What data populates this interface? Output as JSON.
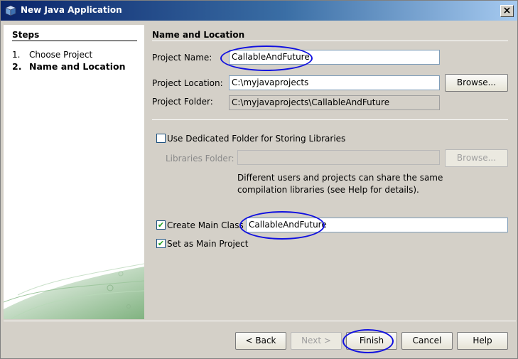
{
  "window": {
    "title": "New Java Application",
    "close": "×"
  },
  "steps": {
    "title": "Steps",
    "items": [
      {
        "num": "1.",
        "label": "Choose Project"
      },
      {
        "num": "2.",
        "label": "Name and Location"
      }
    ]
  },
  "form": {
    "section_title": "Name and Location",
    "project_name": {
      "label": "Project Name:",
      "value": "CallableAndFuture"
    },
    "project_location": {
      "label": "Project Location:",
      "value": "C:\\myjavaprojects",
      "browse": "Browse..."
    },
    "project_folder": {
      "label": "Project Folder:",
      "value": "C:\\myjavaprojects\\CallableAndFuture"
    },
    "dedicated_folder": {
      "label": "Use Dedicated Folder for Storing Libraries",
      "checked": false
    },
    "libraries_folder": {
      "label": "Libraries Folder:",
      "value": "",
      "browse": "Browse..."
    },
    "hint_line1": "Different users and projects can share the same",
    "hint_line2": "compilation libraries (see Help for details).",
    "create_main_class": {
      "label": "Create Main Class",
      "value": "CallableAndFuture",
      "checked": true
    },
    "set_main_project": {
      "label": "Set as Main Project",
      "checked": true
    }
  },
  "buttons": {
    "back": "< Back",
    "next": "Next >",
    "finish": "Finish",
    "cancel": "Cancel",
    "help": "Help"
  },
  "colors": {
    "annotation": "#1010e0",
    "titlebar": "#0a246a"
  }
}
